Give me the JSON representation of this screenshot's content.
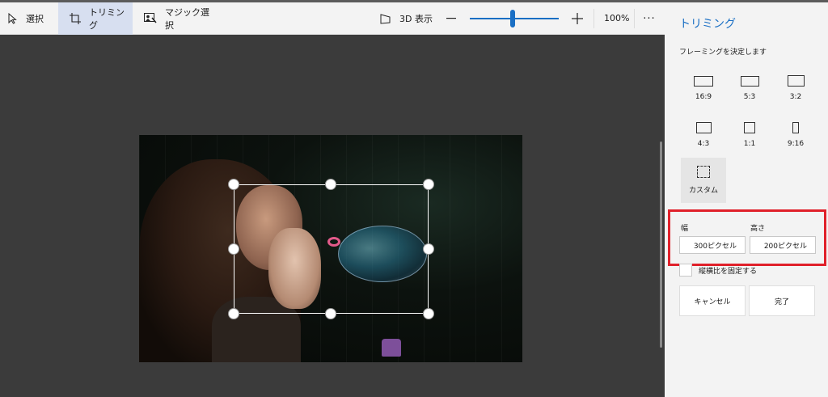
{
  "toolbar": {
    "select_label": "選択",
    "crop_label": "トリミング",
    "magic_select_label": "マジック選択",
    "view3d_label": "3D 表示",
    "zoom_value": "100%",
    "zoom_level_fraction": 0.48,
    "more_label": "···"
  },
  "panel": {
    "title": "トリミング",
    "subtitle": "フレーミングを決定します",
    "ratios": [
      "16:9",
      "5:3",
      "3:2",
      "4:3",
      "1:1",
      "9:16"
    ],
    "custom_label": "カスタム",
    "width_label": "幅",
    "height_label": "高さ",
    "width_value": "300ピクセル",
    "height_value": "200ピクセル",
    "lock_ratio_label": "縦横比を固定する",
    "cancel_label": "キャンセル",
    "done_label": "完了"
  },
  "colors": {
    "accent": "#1a6fc4",
    "highlight_border": "#e0202a",
    "toolbar_bg": "#f3f3f3",
    "canvas_bg": "#3b3b3b"
  },
  "icons": [
    "cursor-icon",
    "crop-icon",
    "magic-select-icon",
    "3d-view-icon",
    "zoom-out-icon",
    "zoom-in-icon",
    "more-icon"
  ]
}
